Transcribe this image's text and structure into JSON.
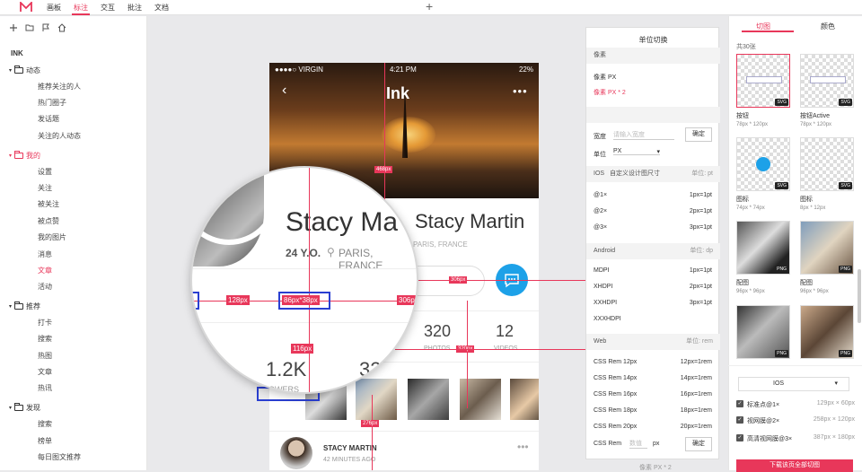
{
  "topbar": {
    "menu": [
      "画板",
      "标注",
      "交互",
      "批注",
      "文档"
    ],
    "active_index": 1,
    "plus_icon": "plus-icon"
  },
  "sidebar": {
    "tools": [
      "plus-icon",
      "folder-icon",
      "flag-icon",
      "home-icon"
    ],
    "root": "INK",
    "groups": [
      {
        "label": "动态",
        "items": [
          "推荐关注的人",
          "热门圈子",
          "发话题",
          "关注的人动态"
        ]
      },
      {
        "label": "我的",
        "items": [
          "设置",
          "关注",
          "被关注",
          "被点赞",
          "我的图片",
          "消息",
          "文章",
          "活动"
        ]
      },
      {
        "label": "推荐",
        "items": [
          "打卡",
          "搜索",
          "热图",
          "文章",
          "热讯"
        ]
      },
      {
        "label": "发现",
        "items": [
          "搜索",
          "榜单",
          "每日图文推荐"
        ]
      }
    ]
  },
  "phone": {
    "status_left": "●●●●○ VIRGIN",
    "status_time": "4:21 PM",
    "status_right": "22%",
    "title": "Ink",
    "name": "Stacy Martin",
    "age": "24 Y.O.",
    "location": "PARIS, FRANCE",
    "stats": [
      {
        "num": "1.2K",
        "label": "FOLLOWERS"
      },
      {
        "num": "320",
        "label": "PHOTOS"
      },
      {
        "num": "12",
        "label": "VIDEOS"
      }
    ],
    "post_name": "STACY MARTIN",
    "post_time": "42 MINUTES AGO"
  },
  "magnifier": {
    "name": "Stacy Ma",
    "age": "24 Y.O.",
    "location": "PARIS, FRANCE",
    "num1": "1.2K",
    "num2": "32",
    "sub": "LOWERS"
  },
  "measures": {
    "m468": "468px",
    "m128": "128px",
    "m86x38": "86px*38px",
    "m306a": "306px",
    "m306b": "306px",
    "m116": "116px",
    "m320": "320px",
    "m276": "276px"
  },
  "unitpanel": {
    "title": "单位切换",
    "sec_pixel": "像素",
    "px1": "像素 PX",
    "px2": "像素 PX * 2",
    "width_label": "宽度",
    "width_placeholder": "请输入宽度",
    "ok": "确定",
    "unit_label": "单位",
    "unit_value": "PX",
    "ios_label": "IOS",
    "ios_custom": "自定义设计图尺寸",
    "ios_unit": "单位: pt",
    "ios_rows": [
      [
        "@1×",
        "1px=1pt"
      ],
      [
        "@2×",
        "2px=1pt"
      ],
      [
        "@3×",
        "3px=1pt"
      ]
    ],
    "android_label": "Android",
    "android_unit": "单位: dp",
    "android_rows": [
      [
        "MDPI",
        "1px=1pt"
      ],
      [
        "XHDPI",
        "2px=1pt"
      ],
      [
        "XXHDPI",
        "3px=1pt"
      ],
      [
        "XXXHDPI",
        ""
      ]
    ],
    "web_label": "Web",
    "web_unit": "单位: rem",
    "web_rows": [
      [
        "CSS Rem 12px",
        "12px=1rem"
      ],
      [
        "CSS Rem 14px",
        "14px=1rem"
      ],
      [
        "CSS Rem 16px",
        "16px=1rem"
      ],
      [
        "CSS Rem 18px",
        "18px=1rem"
      ],
      [
        "CSS Rem 20px",
        "20px=1rem"
      ]
    ],
    "rem_label": "CSS Rem",
    "rem_placeholder": "数值",
    "rem_unit": "px",
    "below_hint": "像素 PX * 2"
  },
  "rpanel": {
    "tabs": [
      "切图",
      "颜色"
    ],
    "count": "共30张",
    "thumbs": [
      {
        "name": "按钮",
        "size": "78px * 120px",
        "badge": "SVG"
      },
      {
        "name": "按钮Active",
        "size": "78px * 120px",
        "badge": "SVG"
      },
      {
        "name": "图标",
        "size": "74px * 74px",
        "badge": "SVG"
      },
      {
        "name": "图标",
        "size": "8px * 12px",
        "badge": "SVG"
      },
      {
        "name": "配图",
        "size": "96px * 96px",
        "badge": "PNG"
      },
      {
        "name": "配图",
        "size": "96px * 96px",
        "badge": "PNG"
      },
      {
        "name": "",
        "size": "",
        "badge": "PNG"
      },
      {
        "name": "",
        "size": "",
        "badge": "PNG"
      }
    ],
    "platform": "IOS",
    "exports": [
      {
        "label": "标准点@1×",
        "size": "129px × 60px"
      },
      {
        "label": "视网膜@2×",
        "size": "258px × 120px"
      },
      {
        "label": "高清视网膜@3×",
        "size": "387px × 180px"
      }
    ],
    "download": "下载该页全部切图"
  },
  "colors": {
    "accent": "#e8375a",
    "chat_blue": "#1da1e8"
  }
}
